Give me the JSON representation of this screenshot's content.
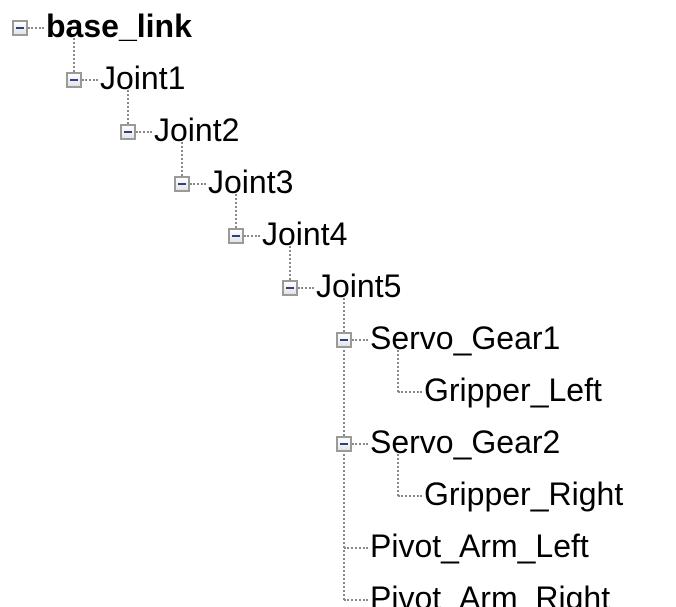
{
  "tree": {
    "nodes": [
      {
        "label": "base_link",
        "depth": 0,
        "expanded": true,
        "bold": true
      },
      {
        "label": "Joint1",
        "depth": 1,
        "expanded": true
      },
      {
        "label": "Joint2",
        "depth": 2,
        "expanded": true
      },
      {
        "label": "Joint3",
        "depth": 3,
        "expanded": true
      },
      {
        "label": "Joint4",
        "depth": 4,
        "expanded": true
      },
      {
        "label": "Joint5",
        "depth": 5,
        "expanded": true
      },
      {
        "label": "Servo_Gear1",
        "depth": 6,
        "expanded": true
      },
      {
        "label": "Gripper_Left",
        "depth": 7
      },
      {
        "label": "Servo_Gear2",
        "depth": 6,
        "expanded": true
      },
      {
        "label": "Gripper_Right",
        "depth": 7
      },
      {
        "label": "Pivot_Arm_Left",
        "depth": 6
      },
      {
        "label": "Pivot_Arm_Right",
        "depth": 6
      }
    ]
  },
  "colors": {
    "connector": "#8a8a8a",
    "toggle_border": "#9a9a9a",
    "toggle_minus": "#2e3c8c",
    "text": "#000000"
  },
  "icons": {
    "expanded_toggle": "minus-box-icon"
  }
}
